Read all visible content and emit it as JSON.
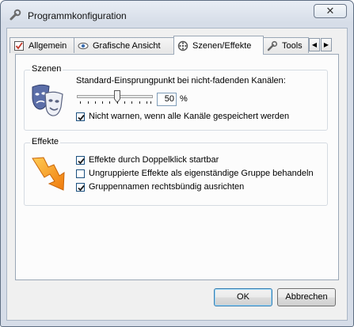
{
  "window": {
    "title": "Programmkonfiguration",
    "close_glyph": "✕"
  },
  "tabs": [
    {
      "label": "Allgemein",
      "icon": "checklist-icon"
    },
    {
      "label": "Grafische Ansicht",
      "icon": "eye-icon"
    },
    {
      "label": "Szenen/Effekte",
      "icon": "film-reel-icon",
      "active": true
    },
    {
      "label": "Tools",
      "icon": "tools-icon"
    }
  ],
  "tab_scroll": {
    "left": "◀",
    "right": "▶"
  },
  "szenen": {
    "group_label": "Szenen",
    "heading": "Standard-Einsprungpunkt bei nicht-fadenden Kanälen:",
    "slider_value": 50,
    "value_text": "50",
    "unit": "%",
    "checkbox_warn": {
      "label": "Nicht warnen, wenn alle Kanäle gespeichert werden",
      "checked": true
    }
  },
  "effekte": {
    "group_label": "Effekte",
    "options": [
      {
        "label": "Effekte durch Doppelklick startbar",
        "checked": true
      },
      {
        "label": "Ungruppierte Effekte als eigenständige Gruppe behandeln",
        "checked": false
      },
      {
        "label": "Gruppennamen rechtsbündig ausrichten",
        "checked": true
      }
    ]
  },
  "buttons": {
    "ok": "OK",
    "cancel": "Abbrechen"
  },
  "colors": {
    "arrow": "#f08a10",
    "masks": "#5b6ea8",
    "check": "#1a1a1a"
  }
}
